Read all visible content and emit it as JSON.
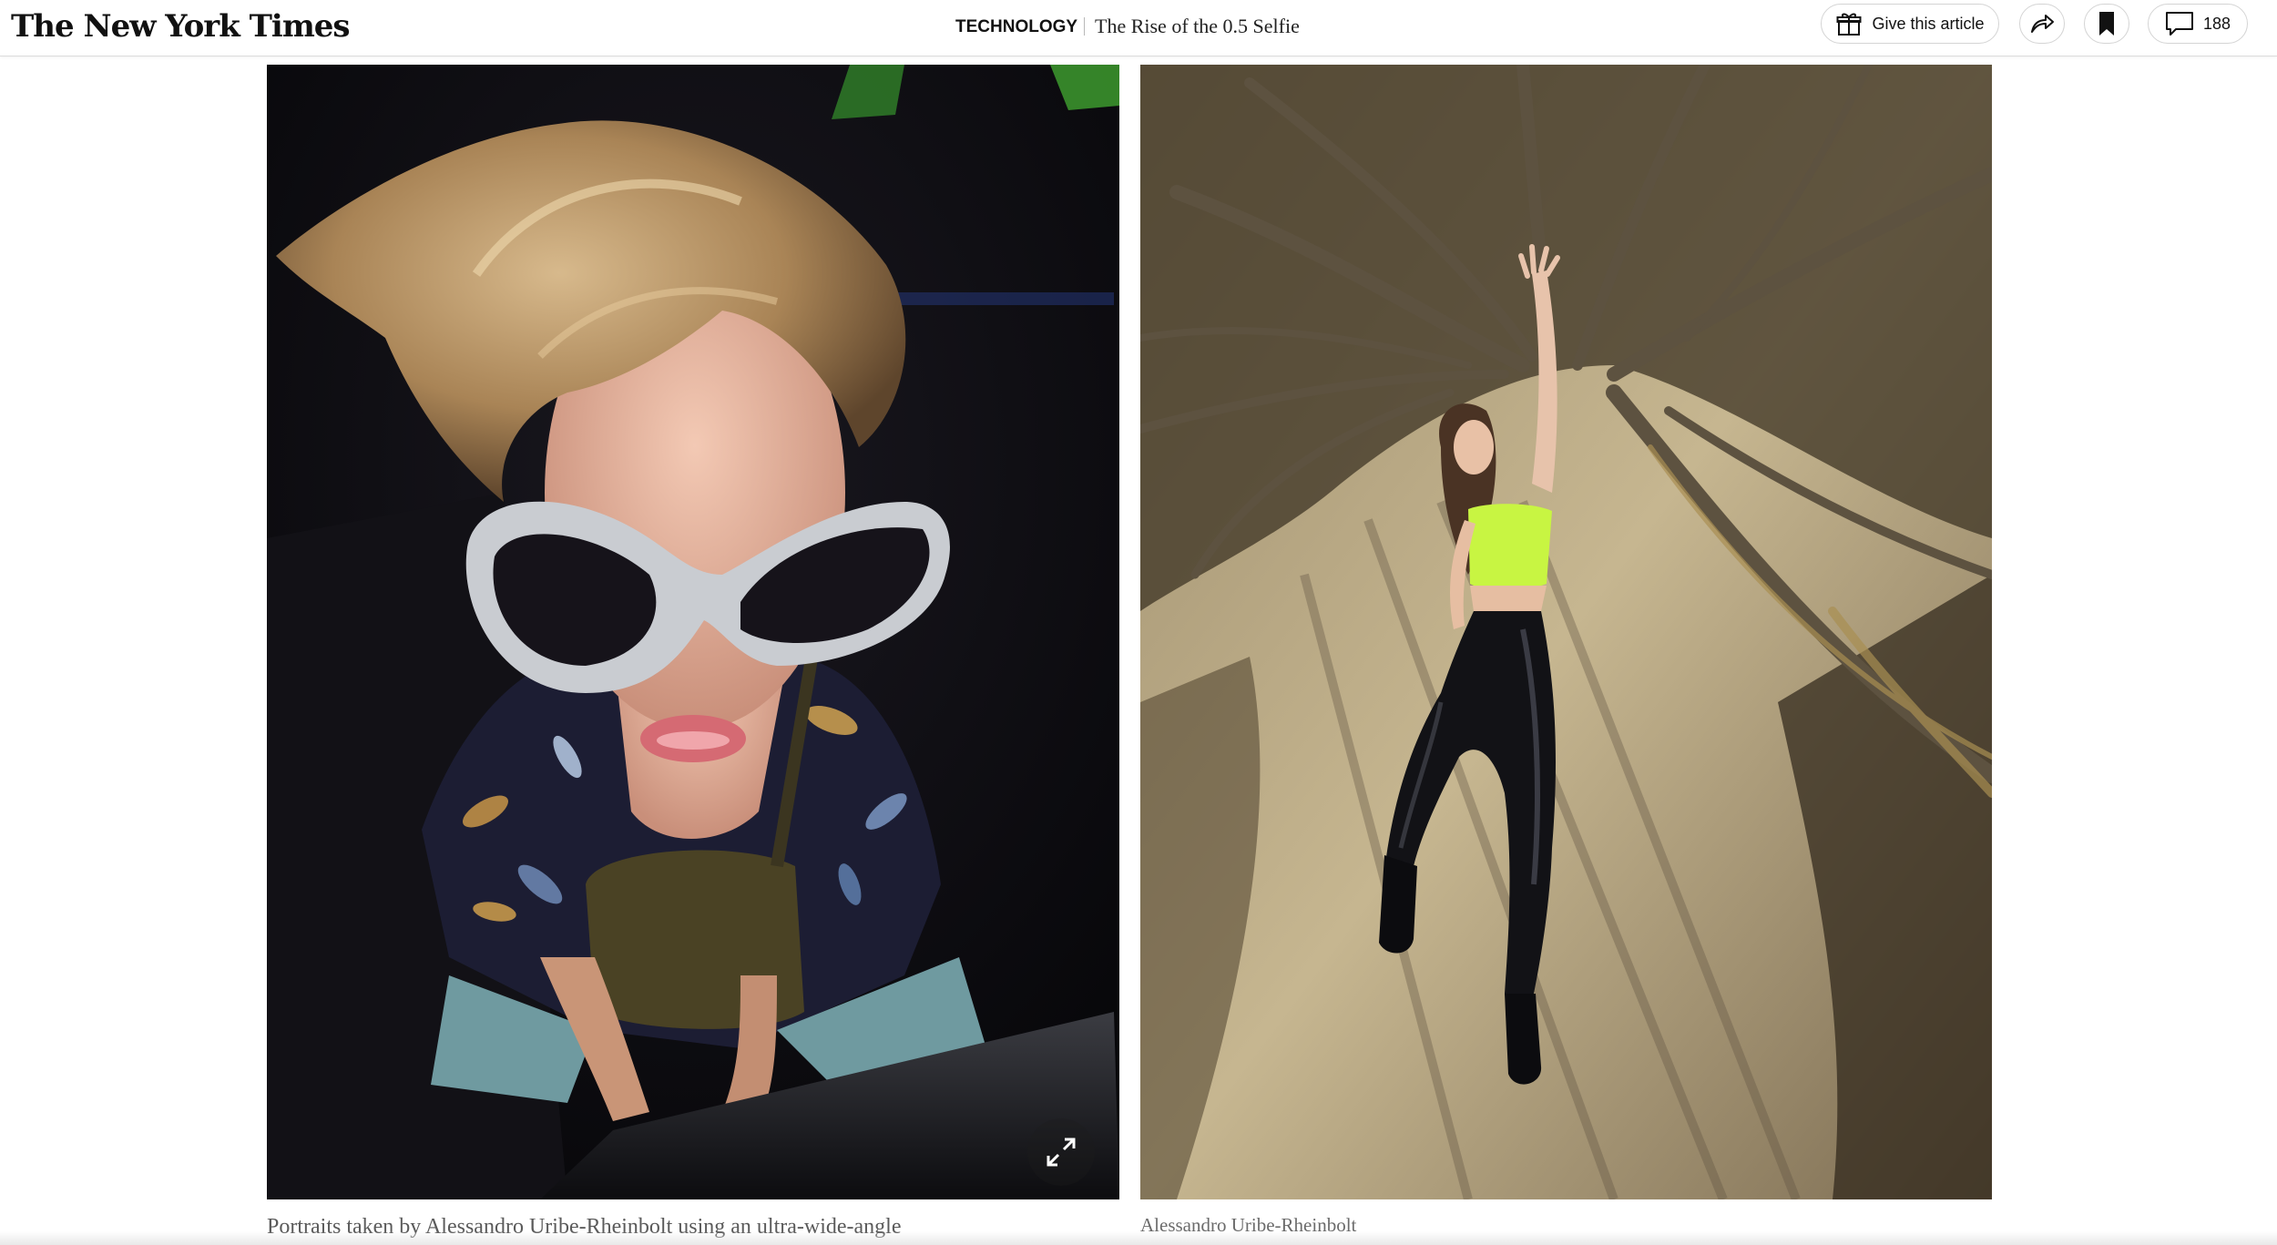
{
  "header": {
    "logo_text": "The New York Times",
    "section": "TECHNOLOGY",
    "article_title": "The Rise of the 0.5 Selfie",
    "gift_label": "Give this article",
    "comment_count": "188"
  },
  "icons": {
    "gift": "gift-icon",
    "share": "share-icon",
    "save": "bookmark-icon",
    "comments": "comment-bubble-icon",
    "expand": "expand-icon"
  },
  "main": {
    "photos": [
      {
        "name": "portrait-man-sunglasses",
        "alt": "man-with-white-sunglasses-photo"
      },
      {
        "name": "portrait-woman-branches",
        "alt": "woman-lying-under-branches-photo"
      }
    ],
    "caption_left": "Portraits taken by Alessandro Uribe-Rheinbolt using an ultra-wide-angle",
    "credit_right": "Alessandro Uribe-Rheinbolt"
  },
  "colors": {
    "text_primary": "#121212",
    "caption_text": "#5a5a5a",
    "border": "#d4d4d4",
    "accent_lime": "#c8f542"
  }
}
